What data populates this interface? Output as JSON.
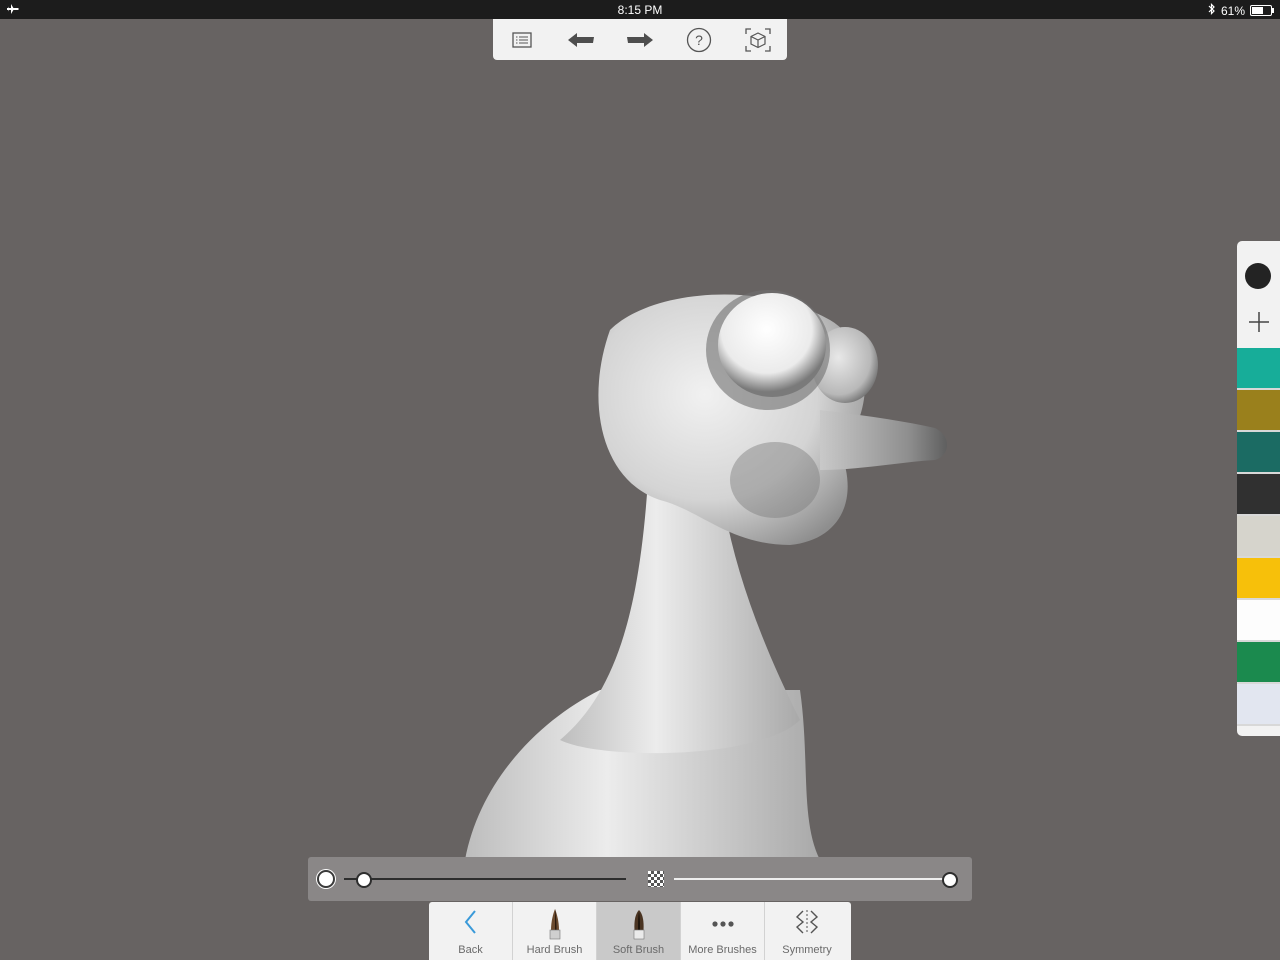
{
  "status_bar": {
    "time": "8:15 PM",
    "battery": "61%",
    "battery_level": 0.61,
    "icons": [
      "airplane-icon",
      "bluetooth-icon",
      "battery-icon"
    ]
  },
  "top_toolbar": {
    "icons": [
      "list-icon",
      "undo-arrow-icon",
      "redo-arrow-icon",
      "help-icon",
      "frame-cube-icon"
    ]
  },
  "palette": {
    "brush_color": "#232323",
    "swatches": [
      "#17ad99",
      "#9a801c",
      "#1b6b63",
      "#303030",
      "#d6d4cc",
      "#f7c00a",
      "#fdfdfd",
      "#1b8a4e",
      "#e2e6f0"
    ]
  },
  "sliders": {
    "size_value": 0.05,
    "opacity_value": 1.0
  },
  "bottom_toolbar": {
    "back": "Back",
    "hard_brush": "Hard Brush",
    "soft_brush": "Soft Brush",
    "more_brushes": "More Brushes",
    "symmetry": "Symmetry",
    "active": "Soft Brush"
  }
}
